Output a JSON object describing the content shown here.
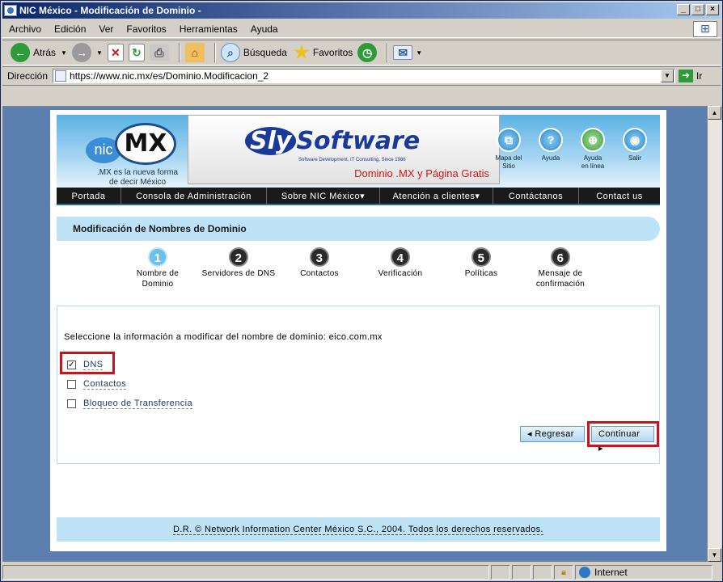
{
  "window": {
    "title": "NIC México - Modificación de Dominio -"
  },
  "menu": [
    "Archivo",
    "Edición",
    "Ver",
    "Favoritos",
    "Herramientas",
    "Ayuda"
  ],
  "toolbar": {
    "back": "Atrás",
    "search": "Búsqueda",
    "favorites": "Favoritos"
  },
  "address": {
    "label": "Dirección",
    "url": "https://www.nic.mx/es/Dominio.Modificacion_2",
    "go": "Ir"
  },
  "site": {
    "logo_nic": "nic",
    "logo_mx": "MX",
    "tagline_line1": ".MX es la nueva forma",
    "tagline_line2": "de decir México",
    "ad_brand_s": "Sly",
    "ad_brand_rest": "Software",
    "ad_sub": "Software Development, IT Consulting, Since 1986",
    "ad_promo": "Dominio .MX y Página Gratis",
    "quick": [
      {
        "label1": "Mapa del",
        "label2": "Sitio"
      },
      {
        "label1": "Ayuda",
        "label2": ""
      },
      {
        "label1": "Ayuda",
        "label2": "en línea"
      },
      {
        "label1": "Salir",
        "label2": ""
      }
    ],
    "nav": [
      "Portada",
      "Consola de Administración",
      "Sobre NIC México▾",
      "Atención a clientes▾",
      "Contáctanos",
      "Contact us"
    ]
  },
  "header": "Modificación de Nombres de Dominio",
  "steps": [
    {
      "num": "1",
      "l1": "Nombre de",
      "l2": "Dominio"
    },
    {
      "num": "2",
      "l1": "Servidores de DNS",
      "l2": ""
    },
    {
      "num": "3",
      "l1": "Contactos",
      "l2": ""
    },
    {
      "num": "4",
      "l1": "Verificación",
      "l2": ""
    },
    {
      "num": "5",
      "l1": "Políticas",
      "l2": ""
    },
    {
      "num": "6",
      "l1": "Mensaje de",
      "l2": "confirmación"
    }
  ],
  "form": {
    "prompt": "Seleccione la información a modificar del nombre de dominio: eico.com.mx",
    "options": [
      {
        "label": "DNS",
        "checked": true
      },
      {
        "label": "Contactos",
        "checked": false
      },
      {
        "label": "Bloqueo de Transferencia",
        "checked": false
      }
    ],
    "back": "◂ Regresar",
    "next": "Continuar ▸"
  },
  "footer": "D.R. © Network Information Center México S.C., 2004. Todos los derechos reservados.",
  "status": {
    "zone": "Internet"
  }
}
